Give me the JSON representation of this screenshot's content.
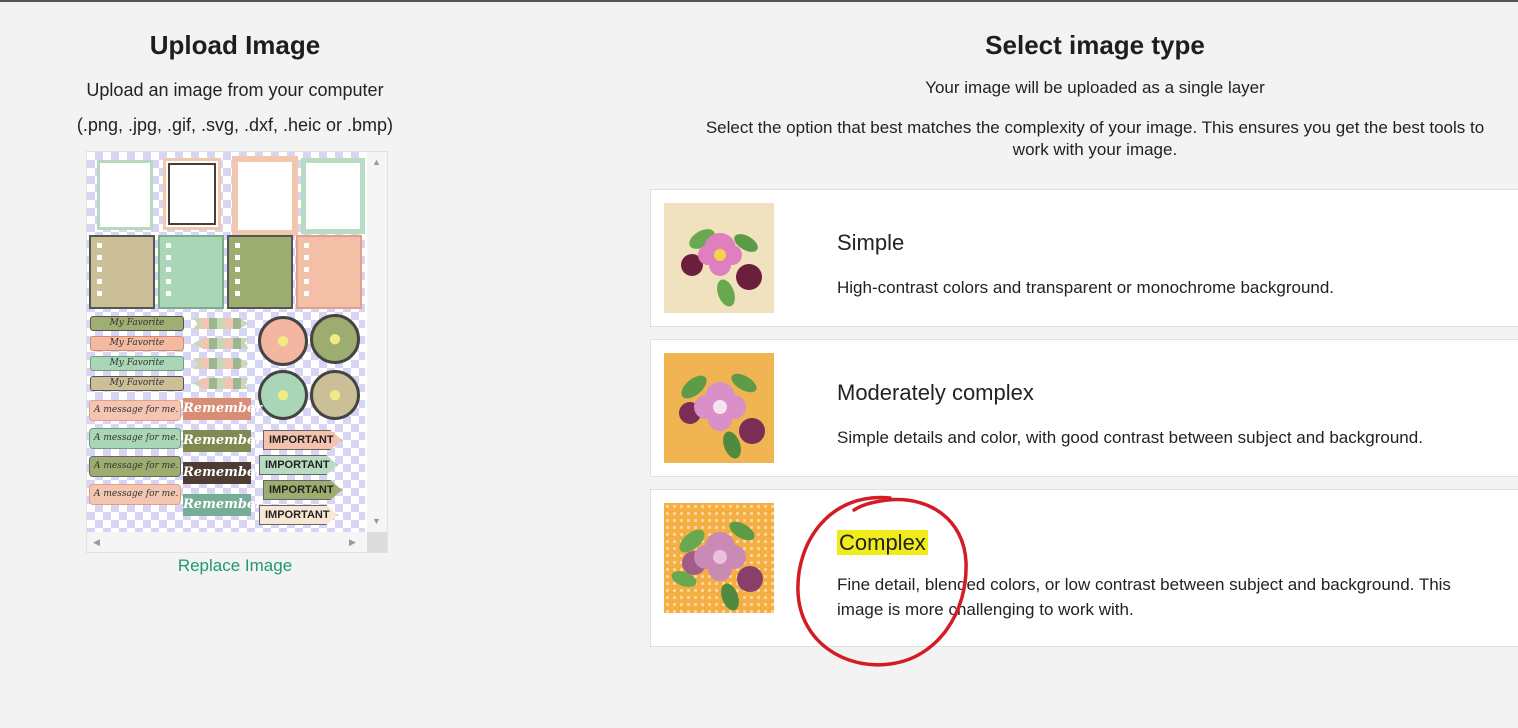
{
  "upload": {
    "title": "Upload Image",
    "subtitle": "Upload an image from your computer",
    "formats": "(.png, .jpg, .gif, .svg, .dxf, .heic or .bmp)",
    "replace_label": "Replace Image",
    "preview": {
      "favorite_label": "My Favorite",
      "message_label": "A message for me.",
      "remember_label": "Remember",
      "important_label": "IMPORTANT"
    }
  },
  "select": {
    "title": "Select image type",
    "subtitle": "Your image will be uploaded as a single layer",
    "instructions_line1": "Select the option that best matches the complexity of your image. This ensures you get the best tools to",
    "instructions_line2": "work with your image."
  },
  "options": [
    {
      "title": "Simple",
      "description": "High-contrast colors and transparent or monochrome background.",
      "thumb_bg": "#f0e1bf"
    },
    {
      "title": "Moderately complex",
      "description": "Simple details and color, with good contrast between subject and background.",
      "thumb_bg": "#f0b552"
    },
    {
      "title": "Complex",
      "description_line1": "Fine detail, blended colors, or low contrast between subject and background. This",
      "description_line2": "image is more challenging to work with.",
      "thumb_bg": "#f5ae41",
      "highlighted": true
    }
  ],
  "colors": {
    "accent_link": "#1f9a6b",
    "highlight": "#f0ec1c",
    "annotation_circle": "#d41c24"
  }
}
